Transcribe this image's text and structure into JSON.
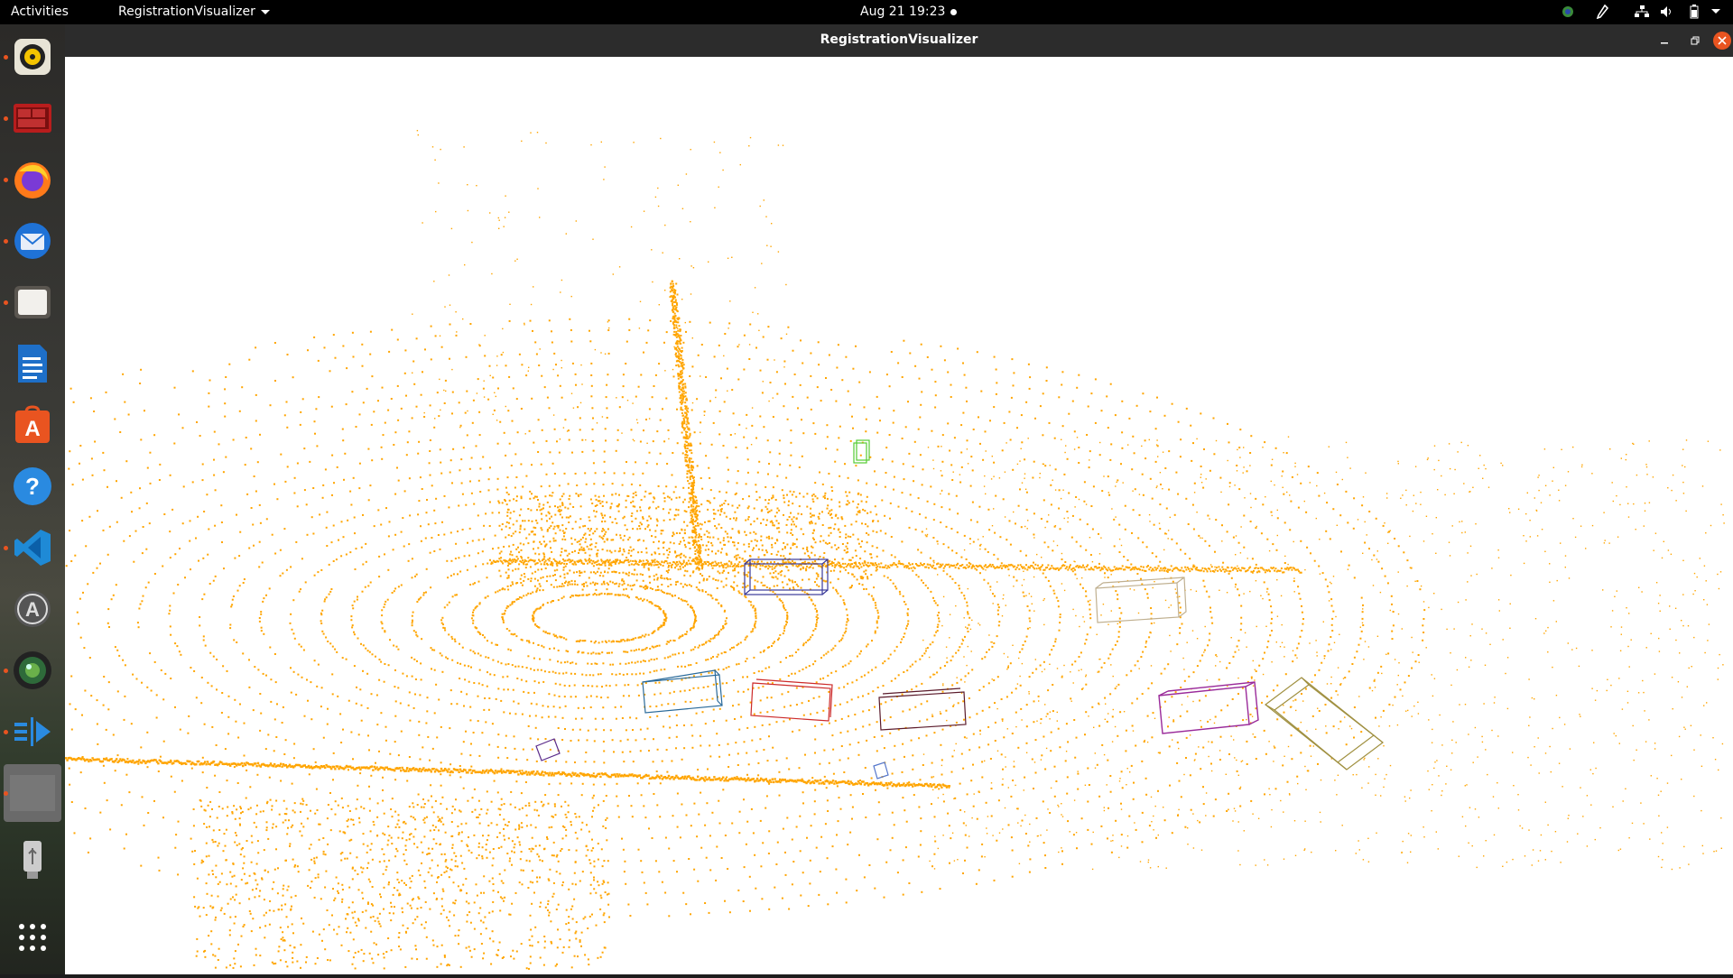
{
  "topbar": {
    "activities": "Activities",
    "app_menu": "RegistrationVisualizer",
    "clock": "Aug 21  19:23",
    "tray_icons": [
      "chrome-icon",
      "pen-icon",
      "network-icon",
      "volume-icon",
      "battery-icon",
      "chevron-down-icon"
    ]
  },
  "dock": {
    "apps": [
      {
        "name": "rhythmbox",
        "icon": "speaker-icon",
        "running": true
      },
      {
        "name": "terminal",
        "icon": "terminal-icon",
        "running": true
      },
      {
        "name": "firefox",
        "icon": "firefox-icon",
        "running": true
      },
      {
        "name": "thunderbird",
        "icon": "mail-icon",
        "running": true
      },
      {
        "name": "files",
        "icon": "folder-icon",
        "running": true
      },
      {
        "name": "libreoffice-writer",
        "icon": "document-icon",
        "running": false
      },
      {
        "name": "software",
        "icon": "store-icon",
        "running": false
      },
      {
        "name": "help",
        "icon": "help-icon",
        "running": false
      },
      {
        "name": "vscode",
        "icon": "vscode-icon",
        "running": true
      },
      {
        "name": "software-updater",
        "icon": "updater-icon",
        "running": false
      },
      {
        "name": "camera-app",
        "icon": "lens-icon",
        "running": true
      },
      {
        "name": "app-launcher",
        "icon": "arrow-icon",
        "running": true
      },
      {
        "name": "registration-visualizer",
        "icon": "window-thumb-icon",
        "running": true
      },
      {
        "name": "usb-drive",
        "icon": "usb-icon",
        "running": false
      },
      {
        "name": "show-applications",
        "icon": "grid-icon",
        "running": false
      }
    ]
  },
  "window": {
    "title": "RegistrationVisualizer",
    "controls": [
      "minimize",
      "maximize",
      "close"
    ]
  },
  "viewer": {
    "background": "#ffffff",
    "point_color": "#ffa500",
    "boxes": [
      {
        "id": "car-1",
        "color": "#3a3a9a"
      },
      {
        "id": "car-2",
        "color": "#2a6a9a"
      },
      {
        "id": "car-3",
        "color": "#cc2a2a"
      },
      {
        "id": "car-4",
        "color": "#5a1a2a"
      },
      {
        "id": "car-5",
        "color": "#c0b090"
      },
      {
        "id": "car-6",
        "color": "#9a2a9a"
      },
      {
        "id": "truck-1",
        "color": "#a09040"
      },
      {
        "id": "pedestrian-1",
        "color": "#55cc33"
      },
      {
        "id": "cyclist-1",
        "color": "#5a2a8a"
      },
      {
        "id": "cyclist-2",
        "color": "#5577cc"
      }
    ]
  }
}
